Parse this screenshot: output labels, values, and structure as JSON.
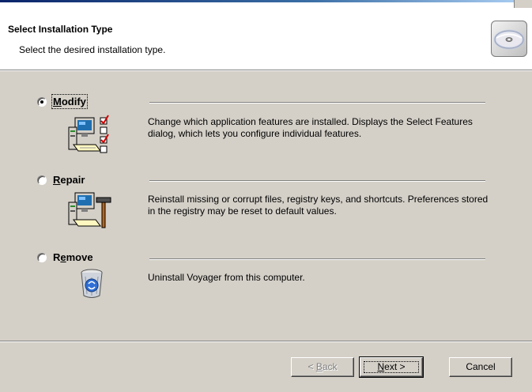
{
  "header": {
    "title": "Select Installation Type",
    "subtitle": "Select the desired installation type.",
    "icon": "cd-disc-icon"
  },
  "options": [
    {
      "label_prefix": "",
      "label_key": "M",
      "label_rest": "odify",
      "selected": true,
      "description": "Change which application features are installed.  Displays the Select Features dialog, which lets you configure individual features.",
      "icon": "modify-computer-checklist-icon"
    },
    {
      "label_prefix": "",
      "label_key": "R",
      "label_rest": "epair",
      "selected": false,
      "description": "Reinstall missing or corrupt files, registry keys, and shortcuts.  Preferences stored in the registry may be reset to default values.",
      "icon": "repair-computer-hammer-icon"
    },
    {
      "label_prefix": "R",
      "label_key": "e",
      "label_rest": "move",
      "selected": false,
      "description": "Uninstall Voyager from this computer.",
      "icon": "recycle-bin-icon"
    }
  ],
  "buttons": {
    "back": {
      "prefix": "< ",
      "key": "B",
      "rest": "ack",
      "enabled": false
    },
    "next": {
      "prefix": "",
      "key": "N",
      "rest": "ext >",
      "enabled": true
    },
    "cancel": {
      "label": "Cancel",
      "enabled": true
    }
  }
}
